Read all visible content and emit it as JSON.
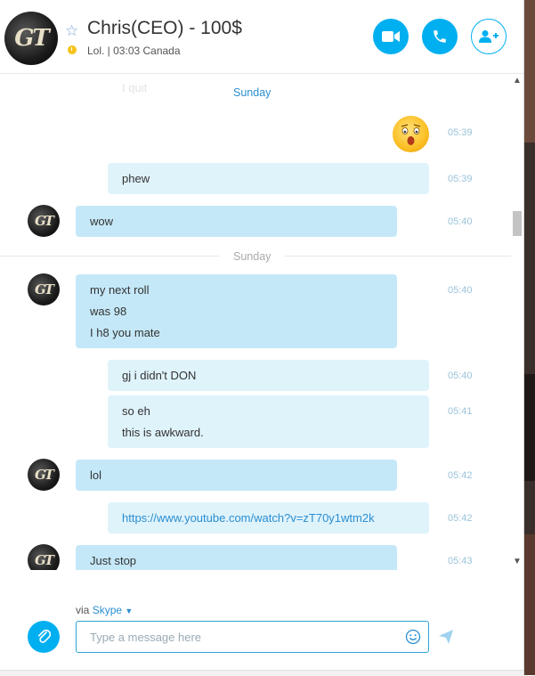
{
  "header": {
    "contact_name": "Chris(CEO) - 100$",
    "mood": "Lol. | 03:03 Canada",
    "avatar_initials": "GT"
  },
  "chat": {
    "ghost_text": "I quit",
    "day_label_1": "Sunday",
    "day_label_2": "Sunday",
    "messages": [
      {
        "from": "me",
        "lines": [
          "phew"
        ],
        "time": "05:39"
      },
      {
        "from": "them",
        "lines": [
          "wow"
        ],
        "time": "05:40"
      },
      {
        "from": "them",
        "lines": [
          "my next roll",
          "was 98",
          "I h8 you mate"
        ],
        "time": "05:40"
      },
      {
        "from": "me",
        "lines": [
          "gj i didn't DON"
        ],
        "time": "05:40"
      },
      {
        "from": "me",
        "lines": [
          "so eh",
          "this is awkward."
        ],
        "time": "05:41"
      },
      {
        "from": "them",
        "lines": [
          "lol"
        ],
        "time": "05:42"
      },
      {
        "from": "me",
        "lines": [
          "https://www.youtube.com/watch?v=zT70y1wtm2k"
        ],
        "time": "05:42"
      },
      {
        "from": "them",
        "lines": [
          "Just stop"
        ],
        "time": "05:43"
      }
    ],
    "emoji_time": "05:39"
  },
  "composer": {
    "via_prefix": "via",
    "via_service": "Skype",
    "placeholder": "Type a message here"
  },
  "colors": {
    "accent": "#00aff0",
    "bubble_mine": "#dff3fb",
    "bubble_theirs": "#c5e8f8",
    "time": "#9bc3d9",
    "status": "#f7c21b"
  },
  "icons": {
    "favorite": "star-icon",
    "video_call": "video-camera-icon",
    "call": "phone-icon",
    "add_people": "add-person-icon",
    "attach": "paperclip-icon",
    "emoticons": "smiley-icon",
    "send": "send-arrow-icon",
    "scroll_up": "chevron-up-icon",
    "scroll_down": "chevron-down-icon"
  }
}
